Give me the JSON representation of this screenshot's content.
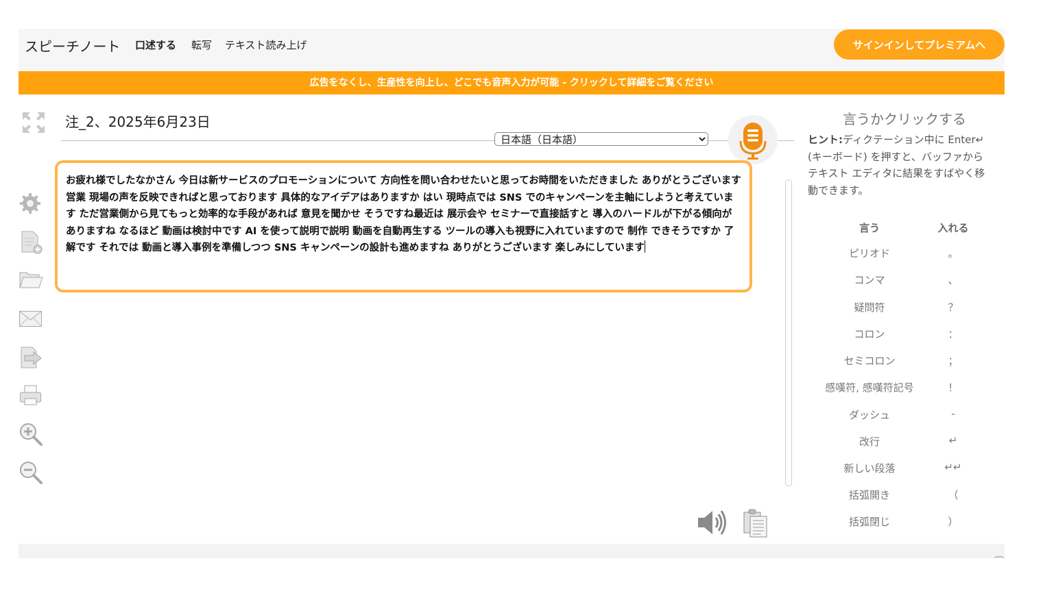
{
  "header": {
    "brand": "スピーチノート",
    "nav": [
      "口述する",
      "転写",
      "テキスト読み上げ"
    ],
    "signin_label": "サインインしてプレミアムへ"
  },
  "banner": {
    "text": "広告をなくし、生産性を向上し、どこでも音声入力が可能 - クリックして詳細をご覧ください"
  },
  "note": {
    "title": "注_2、2025年6月23日",
    "language": "日本語（日本語）",
    "content": "お疲れ様でしたなかさん 今日は新サービスのプロモーションについて 方向性を問い合わせたいと思ってお時間をいただきました ありがとうございます 営業 現場の声を反映できればと思っております 具体的なアイデアはありますか はい 現時点では SNS でのキャンペーンを主軸にしようと考えています ただ営業側から見てもっと効率的な手段があれば 意見を聞かせ そうですね最近は 展示会や セミナーで直接話すと 導入のハードルが下がる傾向がありますね なるほど 動画は検討中です AI を使って説明で説明 動画を自動再生する ツールの導入も視野に入れていますので 制作 できそうですか 了解です それでは 動画と導入事例を準備しつつ SNS キャンペーンの設計も進めますね ありがとうございます 楽しみにしています"
  },
  "sidebar_icons": [
    "fullscreen-icon",
    "settings-gear-icon",
    "new-note-icon",
    "open-folder-icon",
    "email-icon",
    "export-icon",
    "print-icon",
    "zoom-in-icon",
    "zoom-out-icon"
  ],
  "commands": {
    "title": "言うかクリックする",
    "hint_label": "ヒント:",
    "hint_text": "ディクテーション中に Enter↵ (キーボード) を押すと、バッファからテキスト エディタに結果をすばやく移動できます。",
    "col_say": "言う",
    "col_insert": "入れる",
    "rows": [
      {
        "say": "ピリオド",
        "insert": "。"
      },
      {
        "say": "コンマ",
        "insert": "、"
      },
      {
        "say": "疑問符",
        "insert": "？"
      },
      {
        "say": "コロン",
        "insert": "："
      },
      {
        "say": "セミコロン",
        "insert": "；"
      },
      {
        "say": "感嘆符, 感嘆符記号",
        "insert": "！"
      },
      {
        "say": "ダッシュ",
        "insert": "-"
      },
      {
        "say": "改行",
        "insert": "↵"
      },
      {
        "say": "新しい段落",
        "insert": "↵↵"
      },
      {
        "say": "括弧開き",
        "insert": "（"
      },
      {
        "say": "括弧閉じ",
        "insert": "）"
      }
    ]
  },
  "colors": {
    "accent": "#ffa51a",
    "banner": "#ffa20e",
    "editor_border": "#ffb54a",
    "mic": "#f08c10"
  }
}
